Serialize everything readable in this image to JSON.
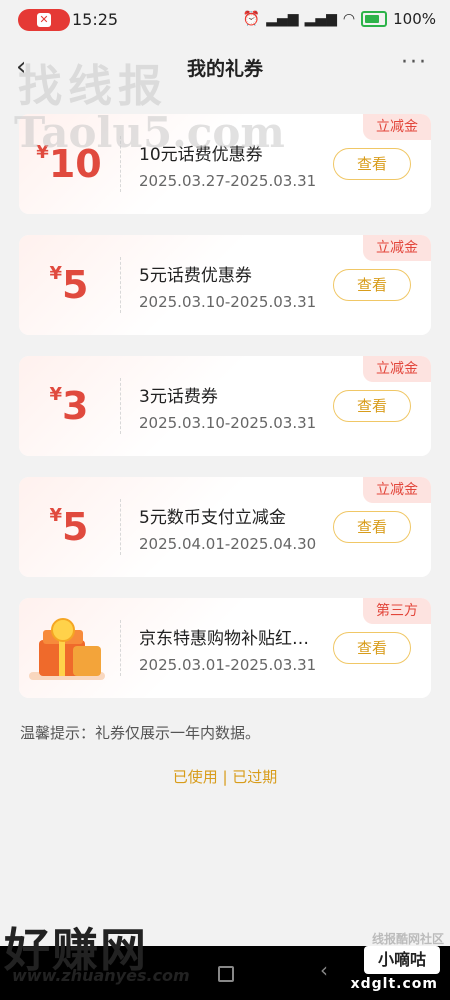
{
  "status_bar": {
    "time": "15:25",
    "battery": "100%",
    "icons": [
      "alarm-icon",
      "hd-signal-icon",
      "hd-signal-icon",
      "wifi-icon",
      "battery-icon"
    ]
  },
  "header": {
    "title": "我的礼券",
    "back_icon": "‹",
    "more_icon": "···"
  },
  "coupons": [
    {
      "tag": "立减金",
      "yen": "¥",
      "amount": "10",
      "title": "10元话费优惠券",
      "date": "2025.03.27-2025.03.31",
      "button": "查看"
    },
    {
      "tag": "立减金",
      "yen": "¥",
      "amount": "5",
      "title": "5元话费优惠券",
      "date": "2025.03.10-2025.03.31",
      "button": "查看"
    },
    {
      "tag": "立减金",
      "yen": "¥",
      "amount": "3",
      "title": "3元话费券",
      "date": "2025.03.10-2025.03.31",
      "button": "查看"
    },
    {
      "tag": "立减金",
      "yen": "¥",
      "amount": "5",
      "title": "5元数币支付立减金",
      "date": "2025.04.01-2025.04.30",
      "button": "查看"
    },
    {
      "tag": "第三方",
      "title": "京东特惠购物补贴红…",
      "date": "2025.03.01-2025.03.31",
      "button": "查看"
    }
  ],
  "tip": "温馨提示：礼券仅展示一年内数据。",
  "links": {
    "used": "已使用",
    "sep": " | ",
    "expired": "已过期"
  },
  "watermarks": {
    "top1": "找线报",
    "top2": "Taolu5.com",
    "bottom1": "好赚网",
    "bottom2": "www.zhuanyes.com",
    "bottom_right": "线报酷网社区",
    "badge": "小嘀咕",
    "badge_url": "xdglt.com"
  },
  "colors": {
    "accent": "#e04a3e",
    "button": "#d89c1a",
    "tag_bg": "#fde3e0"
  }
}
